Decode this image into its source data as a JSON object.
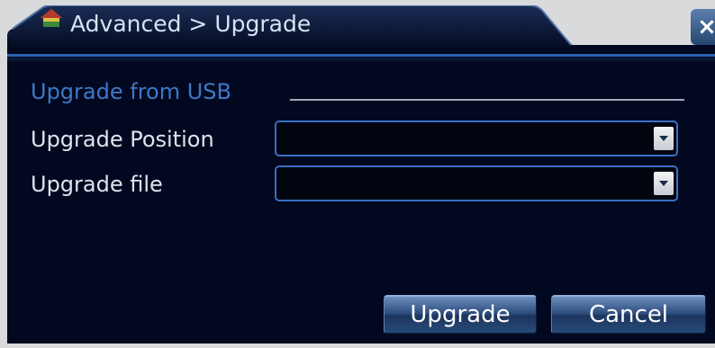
{
  "window": {
    "title": "Advanced > Upgrade",
    "close_label": "×"
  },
  "section": {
    "title": "Upgrade from USB"
  },
  "fields": {
    "position_label": "Upgrade Position",
    "position_value": "",
    "file_label": "Upgrade file",
    "file_value": ""
  },
  "buttons": {
    "upgrade_label": "Upgrade",
    "cancel_label": "Cancel"
  },
  "icons": {
    "title_icon": "home-icon",
    "close_icon": "close-icon",
    "dropdown_icon": "chevron-down-icon"
  },
  "colors": {
    "background": "#020820",
    "accent": "#3a6fc4",
    "section_text": "#3e78c6",
    "label_text": "#dde4ec"
  }
}
